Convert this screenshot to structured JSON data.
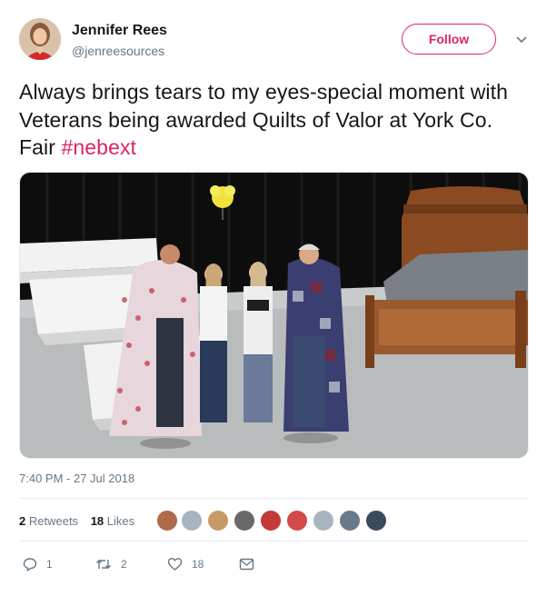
{
  "author": {
    "name": "Jennifer Rees",
    "handle": "@jenreesources"
  },
  "follow_label": "Follow",
  "tweet": {
    "text": "Always brings tears to my eyes-special moment with Veterans being awarded Quilts of Valor at York Co. Fair ",
    "hashtag": "#nebext",
    "timestamp": "7:40 PM - 27 Jul 2018"
  },
  "stats": {
    "retweets_count": "2",
    "retweets_label": "Retweets",
    "likes_count": "18",
    "likes_label": "Likes"
  },
  "actions": {
    "reply_count": "1",
    "retweet_count": "2",
    "like_count": "18"
  },
  "icons": [
    "chevron-down-icon",
    "reply-icon",
    "retweet-icon",
    "heart-icon",
    "message-icon"
  ],
  "colors": {
    "accent": "#e0245e",
    "text": "#14171a",
    "secondary": "#657786",
    "divider": "#e6ecf0"
  }
}
